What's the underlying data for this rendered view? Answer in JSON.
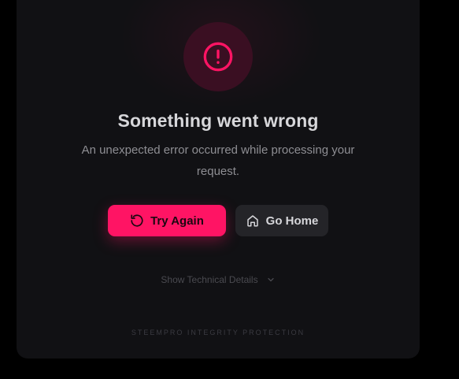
{
  "error": {
    "icon": "alert-circle-icon",
    "title": "Something went wrong",
    "message": "An unexpected error occurred while processing your request."
  },
  "actions": {
    "try_again": {
      "label": "Try Again",
      "icon": "refresh-icon"
    },
    "go_home": {
      "label": "Go Home",
      "icon": "home-icon"
    }
  },
  "details_toggle": {
    "label": "Show Technical Details",
    "icon": "chevron-down-icon"
  },
  "footer": {
    "text": "STEEMPRO INTEGRITY PROTECTION"
  },
  "colors": {
    "background": "#000000",
    "card": "#111114",
    "accent": "#ff1464",
    "icon_bg": "#3a0f22",
    "title": "#d7d7da",
    "muted": "#8e8e93",
    "secondary_button": "#242428"
  }
}
